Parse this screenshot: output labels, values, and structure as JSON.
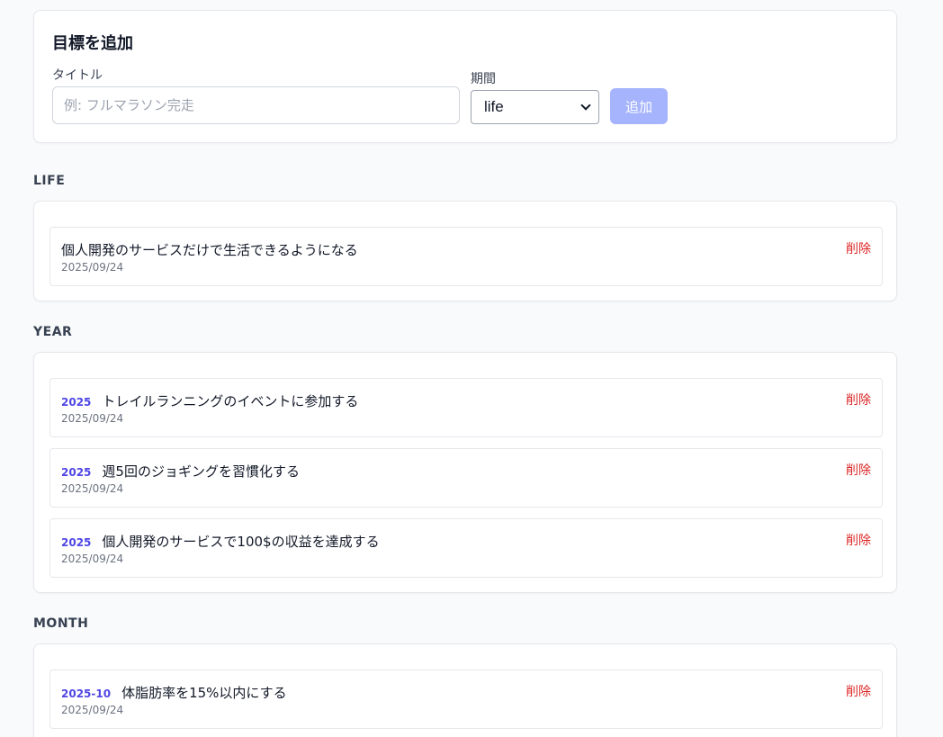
{
  "add_form": {
    "heading": "目標を追加",
    "title_label": "タイトル",
    "title_placeholder": "例: フルマラソン完走",
    "title_value": "",
    "period_label": "期間",
    "period_selected": "life",
    "add_button_label": "追加"
  },
  "delete_label": "削除",
  "sections": {
    "life": {
      "heading": "LIFE",
      "items": [
        {
          "period": "",
          "title": "個人開発のサービスだけで生活できるようになる",
          "date": "2025/09/24"
        }
      ]
    },
    "year": {
      "heading": "YEAR",
      "items": [
        {
          "period": "2025",
          "title": "トレイルランニングのイベントに参加する",
          "date": "2025/09/24"
        },
        {
          "period": "2025",
          "title": "週5回のジョギングを習慣化する",
          "date": "2025/09/24"
        },
        {
          "period": "2025",
          "title": "個人開発のサービスで100$の収益を達成する",
          "date": "2025/09/24"
        }
      ]
    },
    "month": {
      "heading": "MONTH",
      "items": [
        {
          "period": "2025-10",
          "title": "体脂肪率を15%以内にする",
          "date": "2025/09/24"
        }
      ]
    }
  },
  "colors": {
    "accent": "#4f46e5",
    "button_disabled": "#a5b4fc",
    "delete": "#dc2626",
    "background": "#f9fafb"
  }
}
